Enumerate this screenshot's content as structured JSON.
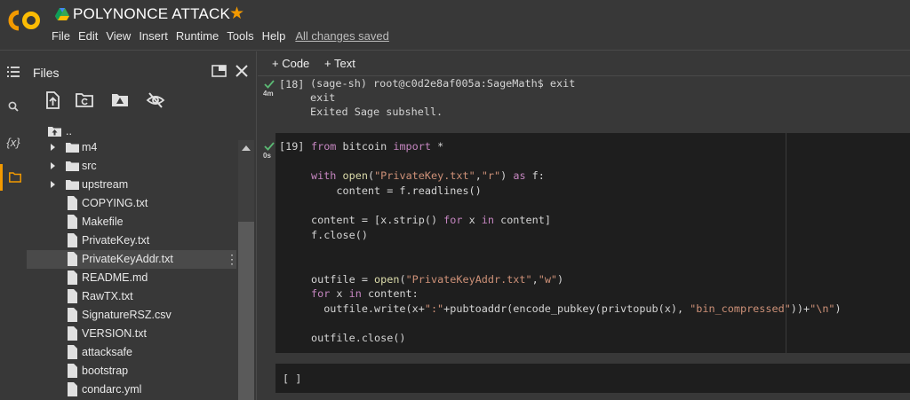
{
  "header": {
    "title": "POLYNONCE ATTACK",
    "menu": [
      "File",
      "Edit",
      "View",
      "Insert",
      "Runtime",
      "Tools",
      "Help"
    ],
    "save_status": "All changes saved",
    "brand_color": "#f29900"
  },
  "rail": {
    "variables_label": "{x}"
  },
  "files": {
    "title": "Files",
    "parent": "..",
    "items": [
      {
        "name": "m4",
        "type": "folder"
      },
      {
        "name": "src",
        "type": "folder"
      },
      {
        "name": "upstream",
        "type": "folder"
      },
      {
        "name": "COPYING.txt",
        "type": "file"
      },
      {
        "name": "Makefile",
        "type": "file"
      },
      {
        "name": "PrivateKey.txt",
        "type": "file"
      },
      {
        "name": "PrivateKeyAddr.txt",
        "type": "file",
        "selected": true
      },
      {
        "name": "README.md",
        "type": "file"
      },
      {
        "name": "RawTX.txt",
        "type": "file"
      },
      {
        "name": "SignatureRSZ.csv",
        "type": "file"
      },
      {
        "name": "VERSION.txt",
        "type": "file"
      },
      {
        "name": "attacksafe",
        "type": "file"
      },
      {
        "name": "bootstrap",
        "type": "file"
      },
      {
        "name": "condarc.yml",
        "type": "file"
      }
    ]
  },
  "notebook": {
    "add_code": "+ Code",
    "add_text": "+ Text",
    "cell18": {
      "prompt": "[18]",
      "time": "4m",
      "lines": [
        "(sage-sh) root@c0d2e8af005a:SageMath$ exit",
        "exit",
        "Exited Sage subshell."
      ]
    },
    "cell19": {
      "prompt": "[19]",
      "time": "0s"
    },
    "empty_cell_prompt": "[ ]"
  }
}
